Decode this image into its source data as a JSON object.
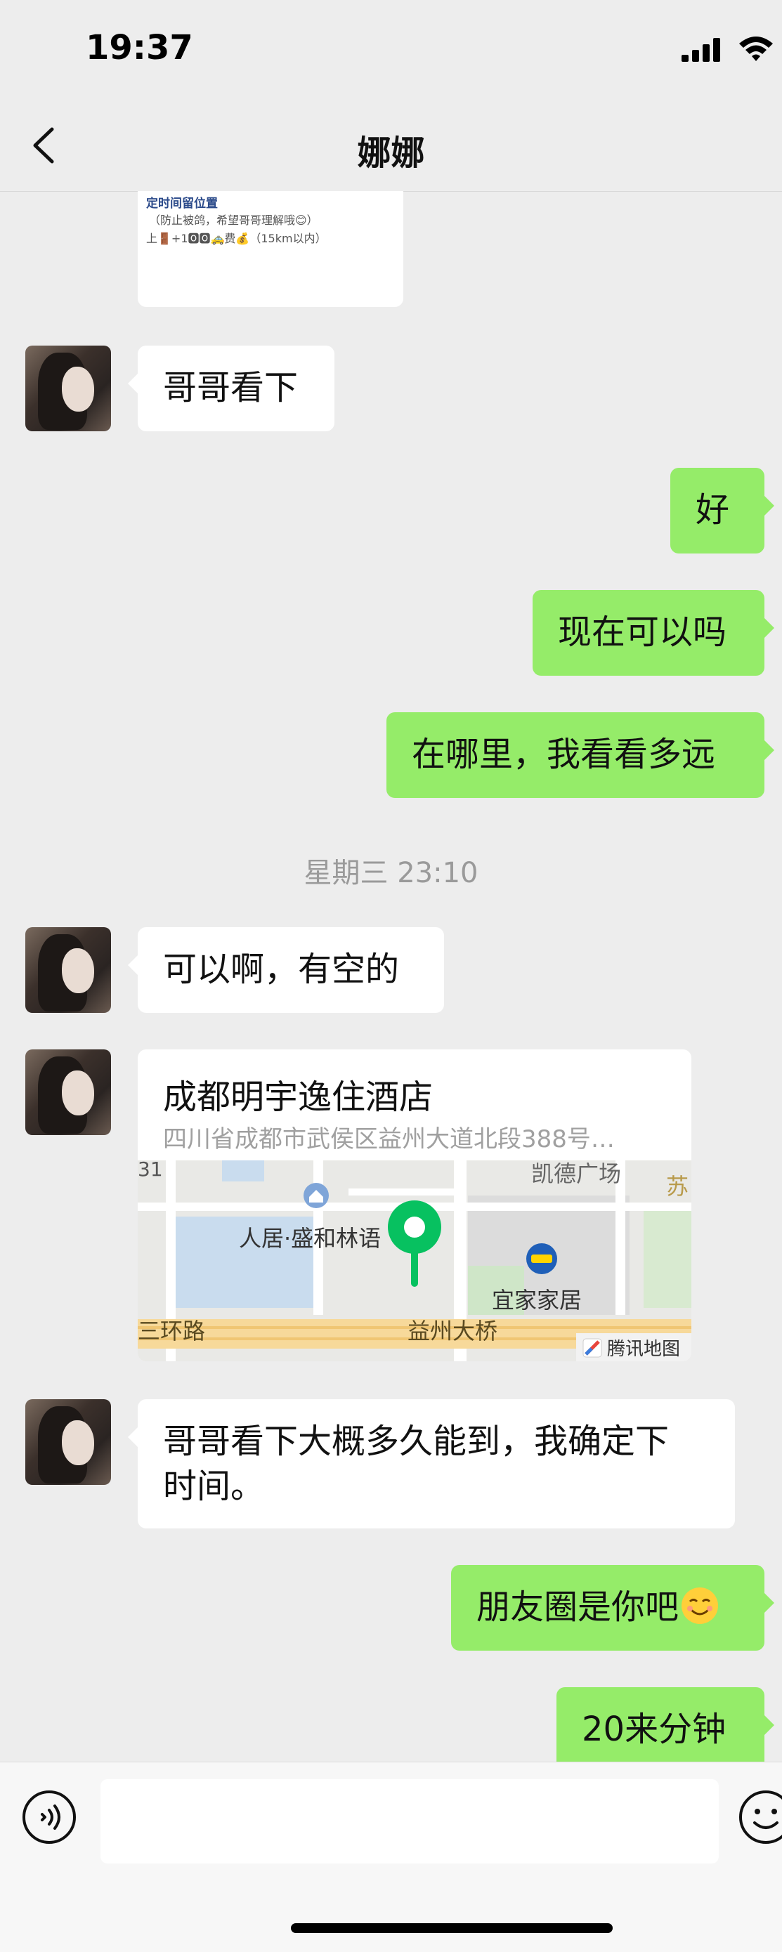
{
  "status": {
    "time": "19:37"
  },
  "nav": {
    "title": "娜娜",
    "back_icon": "chevron-left-icon"
  },
  "top_card": {
    "line1": "定时间留位置",
    "line2": "（防止被鸽，希望哥哥理解哦😊）",
    "line3": "上🚪+1🅾🅾🚕费💰（15km以内）"
  },
  "messages": [
    {
      "side": "left",
      "text": "哥哥看下"
    },
    {
      "side": "right",
      "text": "好"
    },
    {
      "side": "right",
      "text": "现在可以吗"
    },
    {
      "side": "right",
      "text": "在哪里，我看看多远"
    },
    {
      "side": "left",
      "text": "可以啊，有空的"
    },
    {
      "side": "left",
      "text": "哥哥看下大概多久能到，我确定下",
      "text2": "时间。"
    },
    {
      "side": "right",
      "text": "朋友圈是你吧"
    },
    {
      "side": "right",
      "text": "20来分钟"
    }
  ],
  "timestamp": "星期三 23:10",
  "location": {
    "name": "成都明宇逸住酒店",
    "address": "四川省成都市武侯区益州大道北段388号…",
    "map_labels": {
      "kaide": "凯德广场",
      "su": "苏",
      "renju": "人居·盛和林语",
      "yijia": "宜家家居",
      "sanhuan": "三环路",
      "yizhou": "益州大桥",
      "tencent": "腾讯地图",
      "num31": "31"
    }
  },
  "colors": {
    "background": "#ededed",
    "bubble_right": "#95ec69",
    "bubble_left": "#ffffff",
    "pin": "#07c160"
  }
}
